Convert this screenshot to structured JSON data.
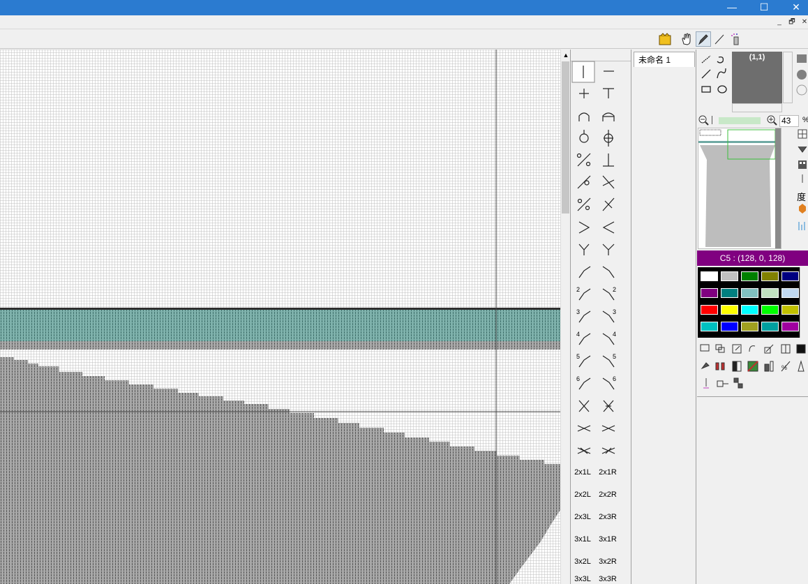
{
  "window": {
    "controls": [
      "—",
      "☐",
      "✕"
    ]
  },
  "mdi_controls": [
    "_",
    "🗗",
    "✕"
  ],
  "toolbar": {
    "icons": [
      "fill-icon",
      "hand-icon",
      "pen-icon",
      "line-icon",
      "spray-icon"
    ]
  },
  "document_tab": {
    "label": "未命名 1"
  },
  "stitch_palette": {
    "text_items": [
      [
        "2x1L",
        "2x1R"
      ],
      [
        "2x2L",
        "2x2R"
      ],
      [
        "2x3L",
        "2x3R"
      ],
      [
        "3x1L",
        "3x1R"
      ],
      [
        "3x2L",
        "3x2R"
      ],
      [
        "3x3L",
        "3x3R"
      ]
    ],
    "number_labels": [
      "2",
      "3",
      "4",
      "5",
      "6"
    ]
  },
  "preview": {
    "coordinate": "(1,1)"
  },
  "zoom": {
    "value": "43",
    "unit": "%"
  },
  "color_status": {
    "label": "C5 : (128, 0, 128)"
  },
  "side_label": "度",
  "palette_colors": [
    [
      "#ffffff",
      "#c0c0c0",
      "#008000",
      "#808000",
      "#000080"
    ],
    [
      "#800080",
      "#008080",
      "#80c0c0",
      "#c0e0c0",
      "#c0d8f0"
    ],
    [
      "#ff0000",
      "#ffff00",
      "#00ffff",
      "#00ff00",
      "#c0c000"
    ],
    [
      "#00c0c0",
      "#0000ff",
      "#a0a020",
      "#00a0a0",
      "#a000a0"
    ]
  ],
  "colors": {
    "title_bar": "#2b7bd0",
    "selected_color": "#800080",
    "knit_band": "#6fa9a3",
    "knit_gray": "#a8a8a8"
  }
}
